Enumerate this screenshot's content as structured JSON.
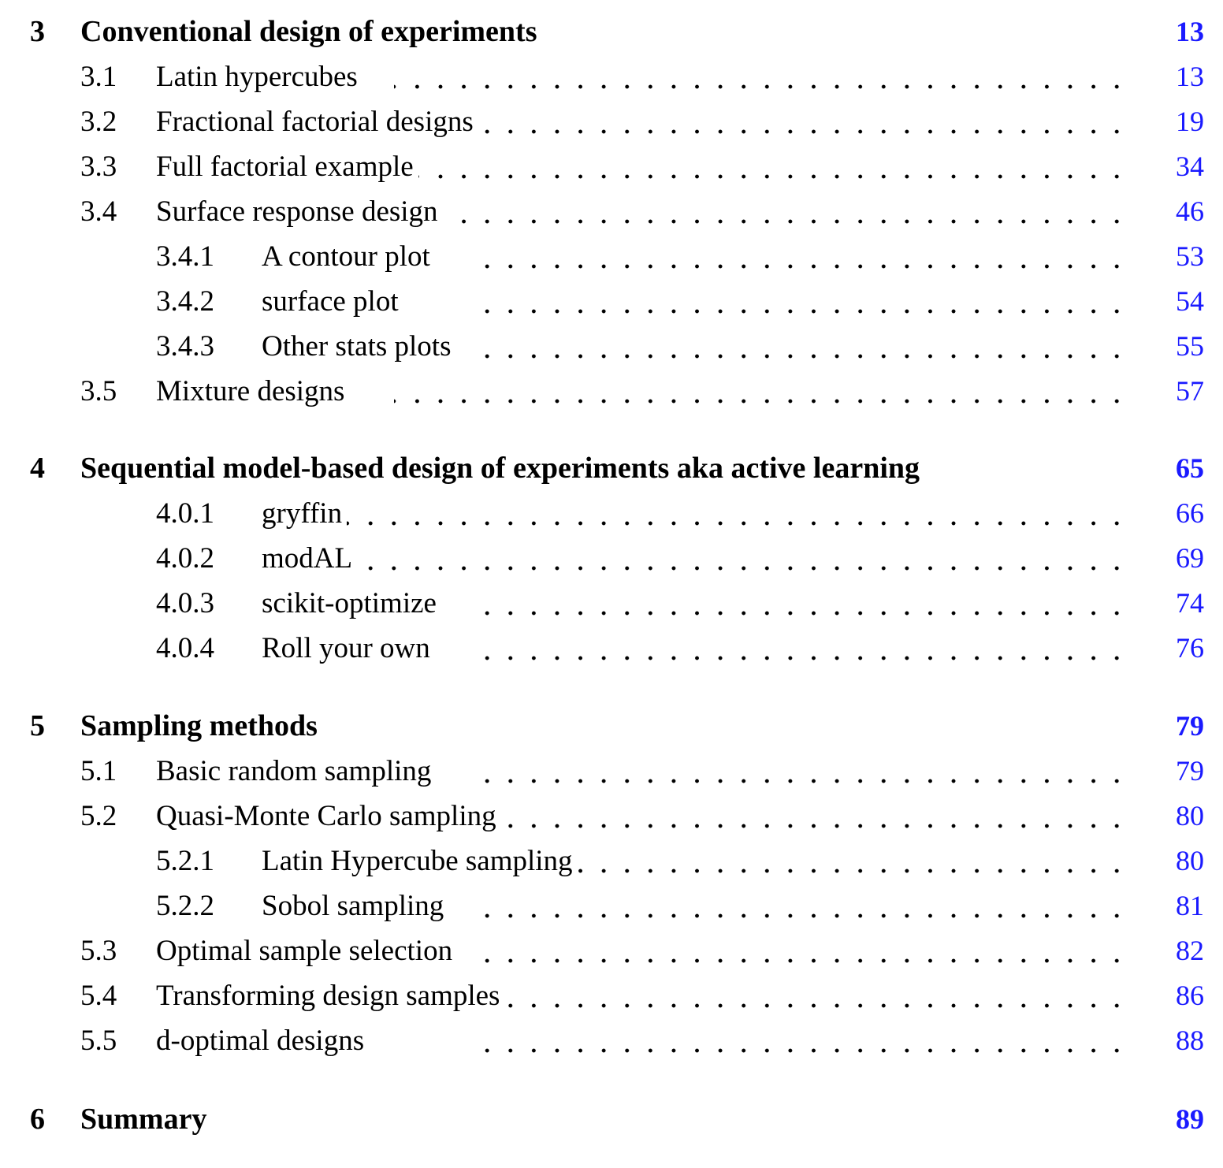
{
  "accent_color": "#1a1aff",
  "toc": [
    {
      "level": "chapter",
      "number": "3",
      "title": "Conventional design of experiments",
      "page": "13"
    },
    {
      "level": "section",
      "number": "3.1",
      "title": "Latin hypercubes",
      "page": "13"
    },
    {
      "level": "section",
      "number": "3.2",
      "title": "Fractional factorial designs",
      "page": "19"
    },
    {
      "level": "section",
      "number": "3.3",
      "title": "Full factorial example",
      "page": "34"
    },
    {
      "level": "section",
      "number": "3.4",
      "title": "Surface response design",
      "page": "46"
    },
    {
      "level": "subsection",
      "number": "3.4.1",
      "title": "A contour plot",
      "page": "53"
    },
    {
      "level": "subsection",
      "number": "3.4.2",
      "title": "surface plot",
      "page": "54"
    },
    {
      "level": "subsection",
      "number": "3.4.3",
      "title": "Other stats plots",
      "page": "55"
    },
    {
      "level": "section",
      "number": "3.5",
      "title": "Mixture designs",
      "page": "57"
    },
    {
      "level": "chapter",
      "number": "4",
      "title": "Sequential model-based design of experiments aka active learning",
      "page": "65"
    },
    {
      "level": "subsection",
      "number": "4.0.1",
      "title": "gryffin",
      "page": "66"
    },
    {
      "level": "subsection",
      "number": "4.0.2",
      "title": "modAL",
      "page": "69"
    },
    {
      "level": "subsection",
      "number": "4.0.3",
      "title": "scikit-optimize",
      "page": "74"
    },
    {
      "level": "subsection",
      "number": "4.0.4",
      "title": "Roll your own",
      "page": "76"
    },
    {
      "level": "chapter",
      "number": "5",
      "title": "Sampling methods",
      "page": "79"
    },
    {
      "level": "section",
      "number": "5.1",
      "title": "Basic random sampling",
      "page": "79"
    },
    {
      "level": "section",
      "number": "5.2",
      "title": "Quasi-Monte Carlo sampling",
      "page": "80"
    },
    {
      "level": "subsection",
      "number": "5.2.1",
      "title": "Latin Hypercube sampling",
      "page": "80"
    },
    {
      "level": "subsection",
      "number": "5.2.2",
      "title": "Sobol sampling",
      "page": "81"
    },
    {
      "level": "section",
      "number": "5.3",
      "title": "Optimal sample selection",
      "page": "82"
    },
    {
      "level": "section",
      "number": "5.4",
      "title": "Transforming design samples",
      "page": "86"
    },
    {
      "level": "section",
      "number": "5.5",
      "title": "d-optimal designs",
      "page": "88"
    },
    {
      "level": "chapter",
      "number": "6",
      "title": "Summary",
      "page": "89"
    }
  ]
}
